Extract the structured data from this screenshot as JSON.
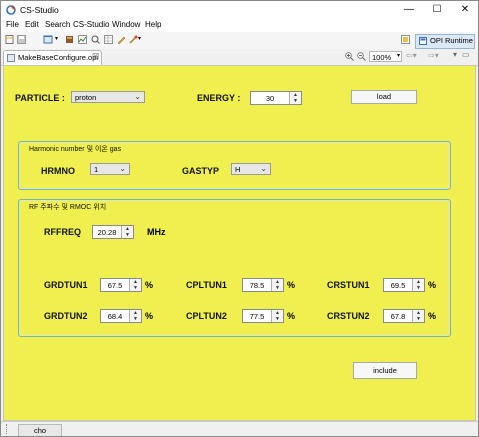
{
  "window": {
    "title": "CS-Studio",
    "minimize_label": "—",
    "maximize_label": "☐",
    "close_label": "✕"
  },
  "menu": [
    "File",
    "Edit",
    "Search",
    "CS-Studio",
    "Window",
    "Help"
  ],
  "toolbar": {
    "opi_runtime_label": "OPI Runtime"
  },
  "editor_tab": {
    "label": "MakeBaseConfigure.opi",
    "close": "☒"
  },
  "zoom": {
    "value": "100%"
  },
  "particle": {
    "label": "PARTICLE :",
    "value": "proton"
  },
  "energy": {
    "label": "ENERGY :",
    "value": "30"
  },
  "load_button": "load",
  "group1": {
    "title": "Harmonic number 및 이온 gas",
    "hrmno": {
      "label": "HRMNO",
      "value": "1"
    },
    "gastyp": {
      "label": "GASTYP",
      "value": "H"
    }
  },
  "group2": {
    "title": "RF 주파수 및 RMOC 위치",
    "rffreq": {
      "label": "RFFREQ",
      "value": "20.28",
      "unit": "MHz"
    },
    "rows": [
      [
        {
          "label": "GRDTUN1",
          "value": "67.5",
          "unit": "%"
        },
        {
          "label": "CPLTUN1",
          "value": "78.5",
          "unit": "%"
        },
        {
          "label": "CRSTUN1",
          "value": "69.5",
          "unit": "%"
        }
      ],
      [
        {
          "label": "GRDTUN2",
          "value": "68.4",
          "unit": "%"
        },
        {
          "label": "CPLTUN2",
          "value": "77.5",
          "unit": "%"
        },
        {
          "label": "CRSTUN2",
          "value": "67.8",
          "unit": "%"
        }
      ]
    ]
  },
  "include_button": "include",
  "status": {
    "user": "cho"
  }
}
